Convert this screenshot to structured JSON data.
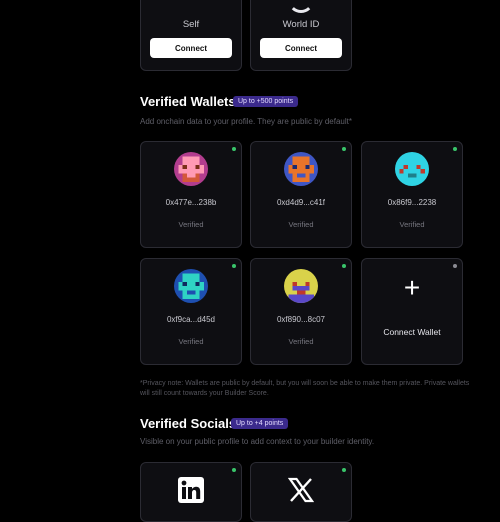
{
  "top_cards": [
    {
      "label": "Self",
      "button": "Connect"
    },
    {
      "label": "World ID",
      "button": "Connect"
    }
  ],
  "wallets": {
    "title": "Verified Wallets",
    "badge": "Up to +500 points",
    "description": "Add onchain data to your profile. They are public by default*",
    "items": [
      {
        "address": "0x477e...238b",
        "status": "Verified"
      },
      {
        "address": "0xd4d9...c41f",
        "status": "Verified"
      },
      {
        "address": "0x86f9...2238",
        "status": "Verified"
      },
      {
        "address": "0xf9ca...d45d",
        "status": "Verified"
      },
      {
        "address": "0xf890...8c07",
        "status": "Verified"
      }
    ],
    "connect_label": "Connect Wallet",
    "privacy_note": "*Privacy note: Wallets are public by default, but you will soon be able to make them private. Private wallets will still count towards your Builder Score."
  },
  "socials": {
    "title": "Verified Socials",
    "badge": "Up to +4 points",
    "description": "Visible on your public profile to add context to your builder identity.",
    "items": [
      {
        "icon": "linkedin-icon"
      },
      {
        "icon": "x-icon"
      }
    ]
  },
  "colors": {
    "background": "#000000",
    "card": "#0e0e12",
    "badge": "#3b2a8c",
    "verified_dot": "#39c46a"
  }
}
